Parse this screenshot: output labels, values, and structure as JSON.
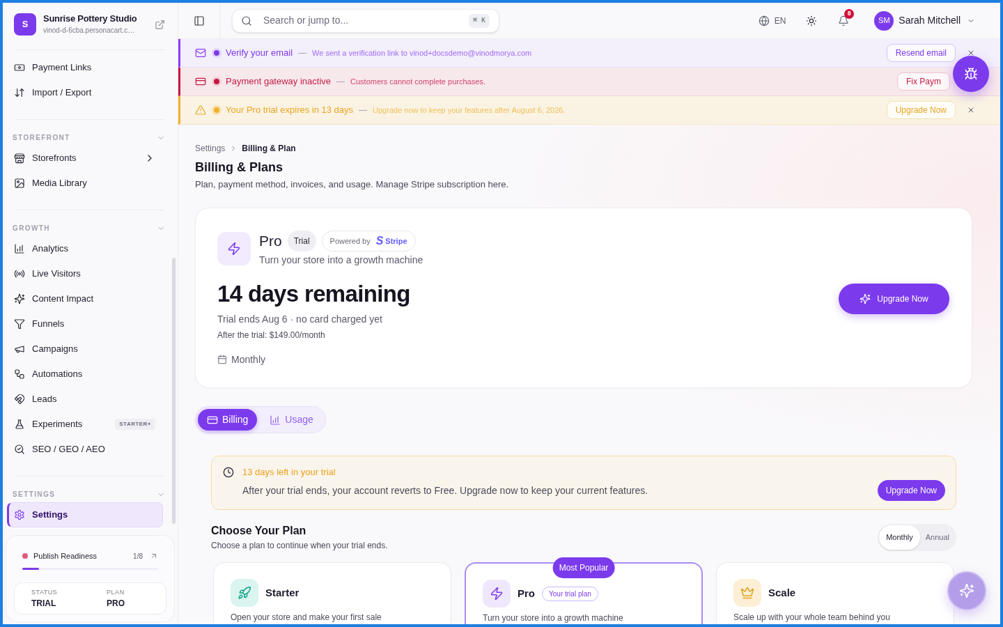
{
  "sidebar": {
    "store": {
      "initial": "S",
      "name": "Sunrise Pottery Studio",
      "url": "vinod-d-6cba.personacart.c…"
    },
    "nav": [
      {
        "items": [
          {
            "label": "Payment Links",
            "selected": false,
            "submenu": false
          },
          {
            "label": "Import / Export",
            "selected": false,
            "submenu": false
          }
        ]
      },
      {
        "title": "STOREFRONT",
        "expanded": true,
        "items": [
          {
            "label": "Storefronts",
            "selected": false,
            "submenu": true
          },
          {
            "label": "Media Library",
            "selected": false,
            "submenu": false
          }
        ]
      },
      {
        "title": "GROWTH",
        "expanded": true,
        "items": [
          {
            "label": "Analytics",
            "selected": false,
            "submenu": false
          },
          {
            "label": "Live Visitors",
            "selected": false,
            "submenu": false
          },
          {
            "label": "Content Impact",
            "selected": false,
            "submenu": false
          },
          {
            "label": "Funnels",
            "selected": false,
            "submenu": false
          },
          {
            "label": "Campaigns",
            "selected": false,
            "submenu": false
          },
          {
            "label": "Automations",
            "selected": false,
            "submenu": false
          },
          {
            "label": "Leads",
            "selected": false,
            "submenu": false
          },
          {
            "label": "Experiments",
            "selected": false,
            "submenu": false,
            "badge": "STARTER+"
          },
          {
            "label": "SEO / GEO / AEO",
            "selected": false,
            "submenu": false
          }
        ]
      },
      {
        "title": "SETTINGS",
        "expanded": true,
        "items": [
          {
            "label": "Settings",
            "selected": true,
            "submenu": false
          }
        ]
      }
    ],
    "readiness": {
      "title": "Publish Readiness",
      "count": "1/8",
      "level": 0.125,
      "stats": [
        {
          "label": "STATUS",
          "value": "TRIAL"
        },
        {
          "label": "PLAN",
          "value": "PRO"
        }
      ]
    }
  },
  "header": {
    "search": {
      "placeholder": "Search or jump to...",
      "shortcut": "⌘ K"
    },
    "language": "EN",
    "notifications": "8",
    "user": {
      "initials": "SM",
      "name": "Sarah Mitchell"
    }
  },
  "banners": [
    {
      "kind": "info",
      "title": "Verify your email",
      "separator": "—",
      "message": "We sent a verification link to vinod+docsdemo@vinodmorya.com",
      "action": "Resend email",
      "dismissible": true
    },
    {
      "kind": "error",
      "title": "Payment gateway inactive",
      "separator": "—",
      "message": "Customers cannot complete purchases.",
      "action": "Fix Paym",
      "dismissible": false
    },
    {
      "kind": "warning",
      "title": "Your Pro trial expires in 13 days",
      "separator": "—",
      "message": "Upgrade now to keep your features after August 6, 2026.",
      "action": "Upgrade Now",
      "dismissible": true
    }
  ],
  "page": {
    "breadcrumb": [
      {
        "label": "Settings",
        "current": false
      },
      {
        "label": "Billing & Plan",
        "current": true
      }
    ],
    "title": "Billing & Plans",
    "subtitle": "Plan, payment method, invoices, and usage. Manage Stripe subscription here."
  },
  "plan_summary": {
    "name": "Pro",
    "badge": "Trial",
    "powered_by": "Powered by",
    "provider_mark": "S",
    "provider": "Stripe",
    "tagline": "Turn your store into a growth machine",
    "headline": "14 days remaining",
    "details": "Trial ends Aug 6 · no card charged yet",
    "after_trial": "After the trial: $149.00/month",
    "billing_cycle": "Monthly",
    "action": "Upgrade Now"
  },
  "tabs": [
    {
      "label": "Billing",
      "selected": true
    },
    {
      "label": "Usage",
      "selected": false
    }
  ],
  "trial_notice": {
    "title": "13 days left in your trial",
    "message": "After your trial ends, your account reverts to Free. Upgrade now to keep your current features.",
    "action": "Upgrade Now"
  },
  "plans": {
    "title": "Choose Your Plan",
    "subtitle": "Choose a plan to continue when your trial ends.",
    "billing_options": [
      {
        "label": "Monthly",
        "selected": true
      },
      {
        "label": "Annual",
        "selected": false
      }
    ],
    "items": [
      {
        "name": "Starter",
        "description": "Open your store and make your first sale",
        "featured": false
      },
      {
        "name": "Pro",
        "badge": "Your trial plan",
        "ribbon": "Most Popular",
        "description": "Turn your store into a growth machine",
        "featured": true
      },
      {
        "name": "Scale",
        "description": "Scale up with your whole team behind you",
        "featured": false
      }
    ]
  }
}
